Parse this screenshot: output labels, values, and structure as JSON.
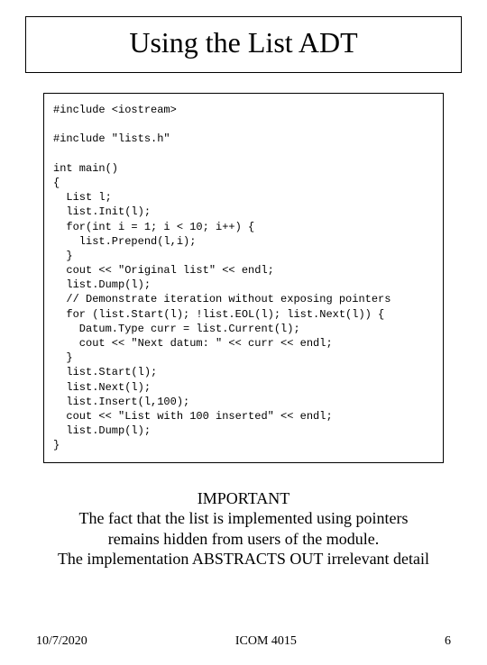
{
  "title": "Using the List ADT",
  "code": "#include <iostream>\n\n#include \"lists.h\"\n\nint main()\n{\n  List l;\n  list.Init(l);\n  for(int i = 1; i < 10; i++) {\n    list.Prepend(l,i);\n  }\n  cout << \"Original list\" << endl;\n  list.Dump(l);\n  // Demonstrate iteration without exposing pointers\n  for (list.Start(l); !list.EOL(l); list.Next(l)) {\n    Datum.Type curr = list.Current(l);\n    cout << \"Next datum: \" << curr << endl;\n  }\n  list.Start(l);\n  list.Next(l);\n  list.Insert(l,100);\n  cout << \"List with 100 inserted\" << endl;\n  list.Dump(l);\n}",
  "note": {
    "heading": "IMPORTANT",
    "line1": "The fact that the list is implemented using pointers",
    "line2": "remains hidden from users of the module.",
    "line3": "The implementation ABSTRACTS OUT irrelevant detail"
  },
  "footer": {
    "date": "10/7/2020",
    "course": "ICOM 4015",
    "page": "6"
  }
}
